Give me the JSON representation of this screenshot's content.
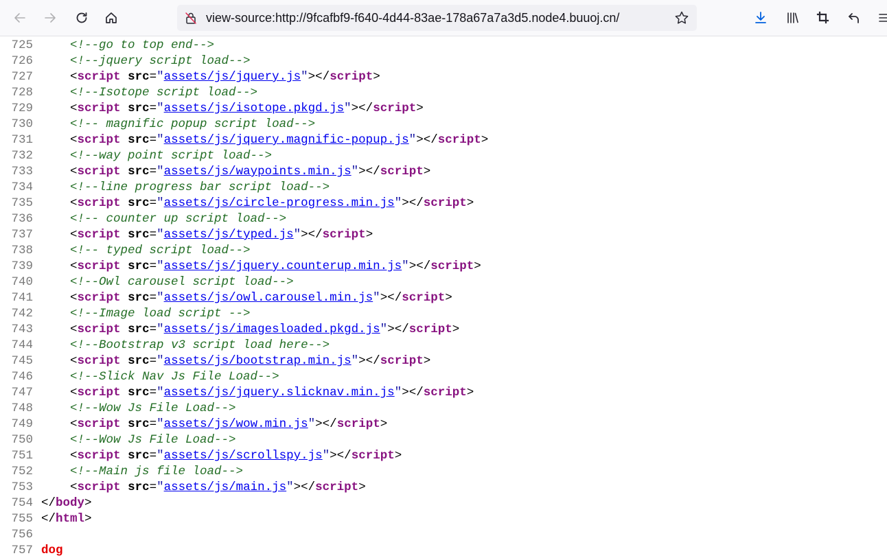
{
  "browser": {
    "url": "view-source:http://9fcafbf9-f640-4d44-83ae-178a67a7a3d5.node4.buuoj.cn/",
    "icons": [
      "back-icon",
      "forward-icon",
      "reload-icon",
      "home-icon",
      "not-secure-icon",
      "bookmark-star-icon",
      "download-icon",
      "library-icon",
      "screenshot-icon",
      "undo-icon",
      "menu-icon"
    ]
  },
  "source": {
    "lines": [
      {
        "n": "725",
        "indent": "    ",
        "comment": "<!--go to top end-->"
      },
      {
        "n": "726",
        "indent": "    ",
        "comment": "<!--jquery script load-->"
      },
      {
        "n": "727",
        "indent": "    ",
        "src": "assets/js/jquery.js"
      },
      {
        "n": "728",
        "indent": "    ",
        "comment": "<!--Isotope script load-->"
      },
      {
        "n": "729",
        "indent": "    ",
        "src": "assets/js/isotope.pkgd.js"
      },
      {
        "n": "730",
        "indent": "    ",
        "comment": "<!-- magnific popup script load-->"
      },
      {
        "n": "731",
        "indent": "    ",
        "src": "assets/js/jquery.magnific-popup.js"
      },
      {
        "n": "732",
        "indent": "    ",
        "comment": "<!--way point script load-->"
      },
      {
        "n": "733",
        "indent": "    ",
        "src": "assets/js/waypoints.min.js"
      },
      {
        "n": "734",
        "indent": "    ",
        "comment": "<!--line progress bar script load-->"
      },
      {
        "n": "735",
        "indent": "    ",
        "src": "assets/js/circle-progress.min.js"
      },
      {
        "n": "736",
        "indent": "    ",
        "comment": "<!-- counter up script load-->"
      },
      {
        "n": "737",
        "indent": "    ",
        "src": "assets/js/typed.js"
      },
      {
        "n": "738",
        "indent": "    ",
        "comment": "<!-- typed script load-->"
      },
      {
        "n": "739",
        "indent": "    ",
        "src": "assets/js/jquery.counterup.min.js"
      },
      {
        "n": "740",
        "indent": "    ",
        "comment": "<!--Owl carousel script load-->"
      },
      {
        "n": "741",
        "indent": "    ",
        "src": "assets/js/owl.carousel.min.js"
      },
      {
        "n": "742",
        "indent": "    ",
        "comment": "<!--Image load script -->"
      },
      {
        "n": "743",
        "indent": "    ",
        "src": "assets/js/imagesloaded.pkgd.js"
      },
      {
        "n": "744",
        "indent": "    ",
        "comment": "<!--Bootstrap v3 script load here-->"
      },
      {
        "n": "745",
        "indent": "    ",
        "src": "assets/js/bootstrap.min.js"
      },
      {
        "n": "746",
        "indent": "    ",
        "comment": "<!--Slick Nav Js File Load-->"
      },
      {
        "n": "747",
        "indent": "    ",
        "src": "assets/js/jquery.slicknav.min.js"
      },
      {
        "n": "748",
        "indent": "    ",
        "comment": "<!--Wow Js File Load-->"
      },
      {
        "n": "749",
        "indent": "    ",
        "src": "assets/js/wow.min.js"
      },
      {
        "n": "750",
        "indent": "    ",
        "comment": "<!--Wow Js File Load-->"
      },
      {
        "n": "751",
        "indent": "    ",
        "src": "assets/js/scrollspy.js"
      },
      {
        "n": "752",
        "indent": "    ",
        "comment": "<!--Main js file load-->"
      },
      {
        "n": "753",
        "indent": "    ",
        "src": "assets/js/main.js"
      },
      {
        "n": "754",
        "indent": "",
        "close": "body"
      },
      {
        "n": "755",
        "indent": "",
        "close": "html"
      },
      {
        "n": "756",
        "indent": ""
      },
      {
        "n": "757",
        "indent": "",
        "text": "dog"
      }
    ]
  }
}
